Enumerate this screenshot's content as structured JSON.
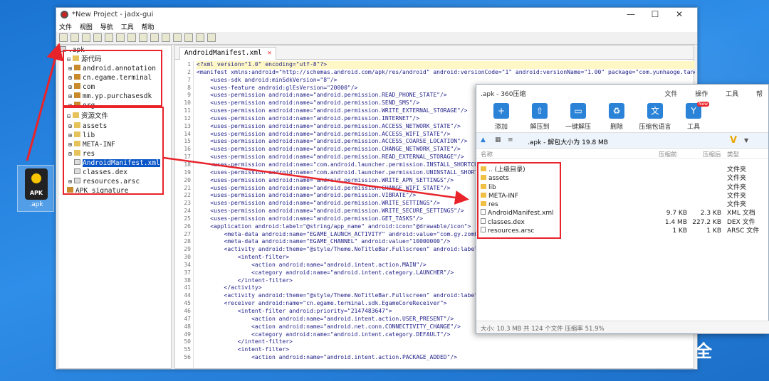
{
  "desktop": {
    "apk_icon_text": "APK",
    "apk_icon_label": ".apk"
  },
  "jadx": {
    "title": "*New Project - jadx-gui",
    "window_buttons": [
      "—",
      "☐",
      "✕"
    ],
    "menu": [
      "文件",
      "视图",
      "导航",
      "工具",
      "帮助"
    ],
    "tree": {
      "root_label": ".apk",
      "source_label": "源代码",
      "packages": [
        "android.annotation",
        "cn.egame.terminal",
        "com",
        "mm.yp.purchasesdk",
        "org"
      ],
      "resources_label": "资源文件",
      "resource_items": [
        "assets",
        "lib",
        "META-INF",
        "res",
        "AndroidManifest.xml",
        "classes.dex",
        "resources.arsc"
      ],
      "signature_label": "APK signature"
    },
    "tab_label": "AndroidManifest.xml",
    "line_numbers": [
      "1",
      "2",
      "7",
      "8",
      "9",
      "10",
      "11",
      "12",
      "13",
      "14",
      "15",
      "16",
      "17",
      "18",
      "19",
      "20",
      "21",
      "22",
      "23",
      "24",
      "25",
      "26",
      "27",
      "28",
      "29",
      "30",
      "34",
      "37",
      "38",
      "41",
      "44",
      "45",
      "46",
      "47",
      "48",
      "49",
      "50",
      "55",
      "56",
      "59",
      "60",
      "63",
      "64",
      "65",
      "66",
      "67",
      "68",
      "69"
    ],
    "code_lines": [
      "<?xml version=\"1.0\" encoding=\"utf-8\"?>",
      "<manifest xmlns:android=\"http://schemas.android.com/apk/res/android\" android:versionCode=\"1\" android:versionName=\"1.00\" package=\"com.yunhaoge.tanc",
      "    <uses-sdk android:minSdkVersion=\"8\"/>",
      "    <uses-feature android:glEsVersion=\"20000\"/>",
      "    <uses-permission android:name=\"android.permission.READ_PHONE_STATE\"/>",
      "    <uses-permission android:name=\"android.permission.SEND_SMS\"/>",
      "    <uses-permission android:name=\"android.permission.WRITE_EXTERNAL_STORAGE\"/>",
      "    <uses-permission android:name=\"android.permission.INTERNET\"/>",
      "    <uses-permission android:name=\"android.permission.ACCESS_NETWORK_STATE\"/>",
      "    <uses-permission android:name=\"android.permission.ACCESS_WIFI_STATE\"/>",
      "    <uses-permission android:name=\"android.permission.ACCESS_COARSE_LOCATION\"/>",
      "    <uses-permission android:name=\"android.permission.CHANGE_NETWORK_STATE\"/>",
      "    <uses-permission android:name=\"android.permission.READ_EXTERNAL_STORAGE\"/>",
      "    <uses-permission android:name=\"com.android.launcher.permission.INSTALL_SHORTCUT",
      "    <uses-permission android:name=\"com.android.launcher.permission.UNINSTALL_SHORTC",
      "    <uses-permission android:name=\"android.permission.WRITE_APN_SETTINGS\"/>",
      "    <uses-permission android:name=\"android.permission.CHANGE_WIFI_STATE\"/>",
      "    <uses-permission android:name=\"android.permission.VIBRATE\"/>",
      "    <uses-permission android:name=\"android.permission.WRITE_SETTINGS\"/>",
      "    <uses-permission android:name=\"android.permission.WRITE_SECURE_SETTINGS\"/>",
      "    <uses-permission android:name=\"android.permission.GET_TASKS\"/>",
      "    <application android:label=\"@string/app_name\" android:icon=\"@drawable/icon\">",
      "        <meta-data android:name=\"EGAME_LAUNCH_ACTIVITY\" android:value=\"com.gy.zombi",
      "        <meta-data android:name=\"EGAME_CHANNEL\" android:value=\"10000000\"/>",
      "        <activity android:theme=\"@style/Theme.NoTitleBar.Fullscreen\" android:label=",
      "            <intent-filter>",
      "                <action android:name=\"android.intent.action.MAIN\"/>",
      "                <category android:name=\"android.intent.category.LAUNCHER\"/>",
      "            </intent-filter>",
      "        </activity>",
      "        <activity android:theme=\"@style/Theme.NoTitleBar.Fullscreen\" android:label=",
      "        <receiver android:name=\"cn.egame.terminal.sdk.EgameCoreReceiver\">",
      "            <intent-filter android:priority=\"2147483647\">",
      "                <action android:name=\"android.intent.action.USER_PRESENT\"/>",
      "                <action android:name=\"android.net.conn.CONNECTIVITY_CHANGE\"/>",
      "                <category android:name=\"android.intent.category.DEFAULT\"/>",
      "            </intent-filter>",
      "            <intent-filter>",
      "                <action android:name=\"android.intent.action.PACKAGE_ADDED\"/>"
    ]
  },
  "zip": {
    "title": ".apk - 360压缩",
    "menu": [
      "文件",
      "操作",
      "工具",
      "帮"
    ],
    "tools": [
      "添加",
      "解压到",
      "一键解压",
      "删除",
      "压缩包语言",
      "工具"
    ],
    "tool_badge": "New",
    "path": ".apk - 解包大小为 19.8 MB",
    "headers": {
      "name": "名称",
      "packed": "压缩前",
      "size": "压缩后",
      "type": "类型"
    },
    "rows": [
      {
        "name": ".. (上级目录)",
        "packed": "",
        "size": "",
        "type": "文件夹",
        "folder": true
      },
      {
        "name": "assets",
        "packed": "",
        "size": "",
        "type": "文件夹",
        "folder": true
      },
      {
        "name": "lib",
        "packed": "",
        "size": "",
        "type": "文件夹",
        "folder": true
      },
      {
        "name": "META-INF",
        "packed": "",
        "size": "",
        "type": "文件夹",
        "folder": true
      },
      {
        "name": "res",
        "packed": "",
        "size": "",
        "type": "文件夹",
        "folder": true
      },
      {
        "name": "AndroidManifest.xml",
        "packed": "9.7 KB",
        "size": "2.3 KB",
        "type": "XML 文档",
        "folder": false
      },
      {
        "name": "classes.dex",
        "packed": "1.4 MB",
        "size": "227.2 KB",
        "type": "DEX 文件",
        "folder": false
      },
      {
        "name": "resources.arsc",
        "packed": "1 KB",
        "size": "1 KB",
        "type": "ARSC 文件",
        "folder": false
      }
    ],
    "status": "大小: 10.3 MB 共 124 个文件 压缩率 51.9%"
  },
  "watermark": "亿人安全"
}
